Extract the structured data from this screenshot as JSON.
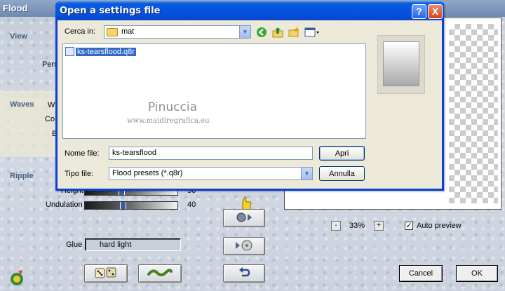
{
  "flood": {
    "title": "Flood",
    "sections": {
      "view": "View",
      "view_partial": "Pers",
      "waves": "Waves",
      "waves_w": "W",
      "waves_co": "Co",
      "waves_e": "E",
      "ripple": "Ripple"
    },
    "sliders": {
      "height": {
        "label": "Height",
        "value": "50"
      },
      "undulation": {
        "label": "Undulation",
        "value": "40"
      }
    },
    "glue": {
      "label": "Glue",
      "value": "hard light"
    },
    "zoom": {
      "minus": "-",
      "value": "33%",
      "plus": "+"
    },
    "auto_preview": {
      "label": "Auto preview",
      "checked": true
    },
    "buttons": {
      "cancel": "Cancel",
      "ok": "OK"
    },
    "icons": {
      "randomize": "dice-icon",
      "reset_wave": "wave-icon",
      "preset_next": "play-icon",
      "preset_load": "disk-icon",
      "undo": "undo-icon",
      "logo": "flower-icon",
      "hand": "pointing-hand-icon"
    }
  },
  "dialog": {
    "title": "Open a settings file",
    "help": "?",
    "close": "X",
    "look_in_label": "Cerca in:",
    "look_in_value": "mat",
    "file_items": [
      {
        "name": "ks-tearsflood.q8r",
        "selected": true
      }
    ],
    "watermark": {
      "name": "Pinuccia",
      "url": "www.maidiregrafica.eu"
    },
    "file_name_label": "Nome file:",
    "file_name_value": "ks-tearsflood",
    "file_type_label": "Tipo file:",
    "file_type_value": "Flood presets (*.q8r)",
    "open_button": "Apri",
    "cancel_button": "Annulla"
  }
}
